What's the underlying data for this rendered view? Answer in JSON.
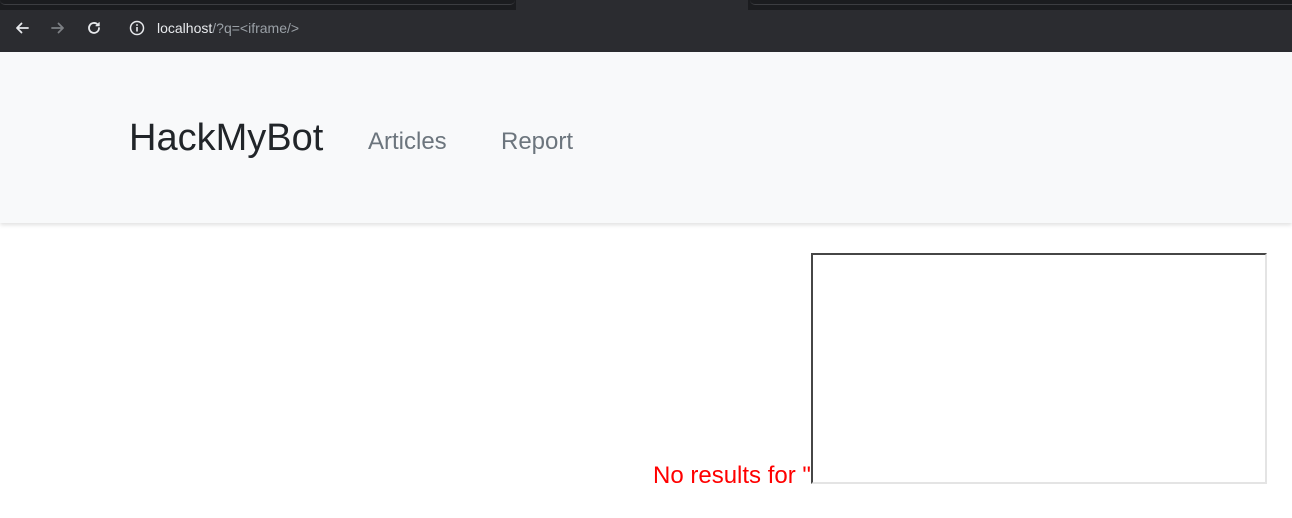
{
  "browser": {
    "url_host": "localhost",
    "url_path": "/?q=<iframe/>",
    "icons": {
      "back": "arrow-left-icon",
      "forward": "arrow-right-icon",
      "reload": "reload-icon",
      "site_info": "info-icon"
    },
    "colors": {
      "chrome_bg": "#202124",
      "toolbar_bg": "#2b2c30",
      "url_text": "#e8eaed",
      "url_path_text": "#9aa0a6"
    }
  },
  "navbar": {
    "brand": "HackMyBot",
    "links": [
      {
        "label": "Articles"
      },
      {
        "label": "Report"
      }
    ],
    "colors": {
      "bg": "#f8f9fa",
      "brand": "#212529",
      "link": "#6c757d"
    }
  },
  "main": {
    "result_text": "No results for \"",
    "result_color": "#ff0000"
  }
}
